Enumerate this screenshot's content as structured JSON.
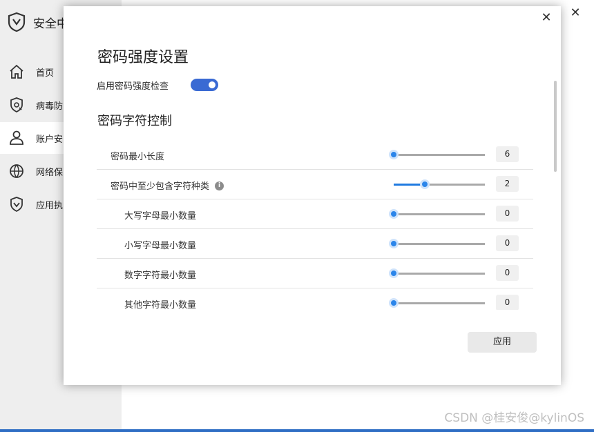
{
  "app": {
    "title": "安全中",
    "close_glyph": "✕",
    "watermark": "CSDN @桂安俊@kylinOS",
    "nav": [
      {
        "label": "首页",
        "icon": "home-icon"
      },
      {
        "label": "病毒防",
        "icon": "virus-shield-icon"
      },
      {
        "label": "账户安",
        "icon": "user-icon",
        "active": true
      },
      {
        "label": "网络保",
        "icon": "globe-icon"
      },
      {
        "label": "应用执",
        "icon": "app-shield-icon"
      }
    ]
  },
  "dialog": {
    "close_glyph": "✕",
    "title": "密码强度设置",
    "toggle": {
      "label": "启用密码强度检查",
      "on": true,
      "color": "#3a6ad3"
    },
    "section_title": "密码字符控制",
    "rows": [
      {
        "label": "密码最小长度",
        "value": "6",
        "slider_fraction": 0.0,
        "indent": false,
        "info": false
      },
      {
        "label": "密码中至少包含字符种类",
        "value": "2",
        "slider_fraction": 0.34,
        "indent": false,
        "info": true
      },
      {
        "label": "大写字母最小数量",
        "value": "0",
        "slider_fraction": 0.0,
        "indent": true,
        "info": false
      },
      {
        "label": "小写字母最小数量",
        "value": "0",
        "slider_fraction": 0.0,
        "indent": true,
        "info": false
      },
      {
        "label": "数字字符最小数量",
        "value": "0",
        "slider_fraction": 0.0,
        "indent": true,
        "info": false
      },
      {
        "label": "其他字符最小数量",
        "value": "0",
        "slider_fraction": 0.0,
        "indent": true,
        "info": false
      }
    ],
    "info_glyph": "i",
    "apply_label": "应用"
  },
  "colors": {
    "accent": "#1f7ae0",
    "bottom_bar": "#2f6ec4"
  }
}
